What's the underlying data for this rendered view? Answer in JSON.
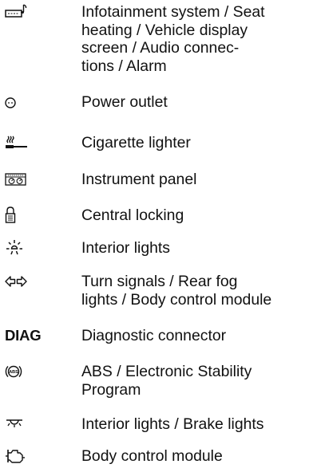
{
  "legend": {
    "rows": [
      {
        "icon": "infotainment-note-icon",
        "label": "Infotainment system / Seat\nheating / Vehicle display\nscreen / Audio connec-\ntions / Alarm"
      },
      {
        "icon": "power-outlet-icon",
        "label": "Power outlet"
      },
      {
        "icon": "cigarette-lighter-icon",
        "label": "Cigarette lighter"
      },
      {
        "icon": "instrument-panel-icon",
        "label": "Instrument panel"
      },
      {
        "icon": "central-locking-icon",
        "label": "Central locking"
      },
      {
        "icon": "interior-light-icon",
        "label": "Interior lights"
      },
      {
        "icon": "turn-signal-arrows-icon",
        "label": "Turn signals / Rear fog\nlights / Body control module"
      },
      {
        "icon": "diag-text",
        "symbol_text": "DIAG",
        "label": "Diagnostic connector"
      },
      {
        "icon": "abs-icon",
        "label": "ABS / Electronic Stability\nProgram"
      },
      {
        "icon": "brake-light-icon",
        "label": "Interior lights / Brake lights"
      },
      {
        "icon": "body-control-module-icon",
        "label": "Body control module"
      }
    ]
  }
}
